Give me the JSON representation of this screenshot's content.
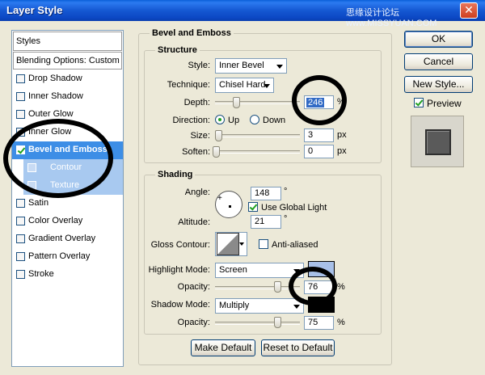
{
  "window": {
    "title": "Layer Style",
    "watermark": "思缘设计论坛 www.MISSYUAN.COM",
    "close_glyph": "✕"
  },
  "styles_panel": {
    "header": "Styles",
    "blending": "Blending Options: Custom",
    "items": [
      {
        "label": "Drop Shadow",
        "checked": false
      },
      {
        "label": "Inner Shadow",
        "checked": false
      },
      {
        "label": "Outer Glow",
        "checked": false
      },
      {
        "label": "Inner Glow",
        "checked": false
      },
      {
        "label": "Bevel and Emboss",
        "checked": true,
        "selected": true
      },
      {
        "label": "Contour",
        "checked": false,
        "sub": true
      },
      {
        "label": "Texture",
        "checked": false,
        "sub": true
      },
      {
        "label": "Satin",
        "checked": false
      },
      {
        "label": "Color Overlay",
        "checked": false
      },
      {
        "label": "Gradient Overlay",
        "checked": false
      },
      {
        "label": "Pattern Overlay",
        "checked": false
      },
      {
        "label": "Stroke",
        "checked": false
      }
    ]
  },
  "bevel": {
    "section_title": "Bevel and Emboss",
    "structure": {
      "title": "Structure",
      "style_label": "Style:",
      "style_value": "Inner Bevel",
      "technique_label": "Technique:",
      "technique_value": "Chisel Hard",
      "depth_label": "Depth:",
      "depth_value": "246",
      "depth_unit": "%",
      "direction_label": "Direction:",
      "direction_up": "Up",
      "direction_down": "Down",
      "size_label": "Size:",
      "size_value": "3",
      "size_unit": "px",
      "soften_label": "Soften:",
      "soften_value": "0",
      "soften_unit": "px"
    },
    "shading": {
      "title": "Shading",
      "angle_label": "Angle:",
      "angle_value": "148",
      "degree": "°",
      "global_light_label": "Use Global Light",
      "global_light_checked": true,
      "altitude_label": "Altitude:",
      "altitude_value": "21",
      "gloss_label": "Gloss Contour:",
      "anti_aliased_label": "Anti-aliased",
      "anti_aliased_checked": false,
      "highlight_label": "Highlight Mode:",
      "highlight_value": "Screen",
      "highlight_color": "#a8c0e8",
      "highlight_opacity_label": "Opacity:",
      "highlight_opacity_value": "76",
      "shadow_label": "Shadow Mode:",
      "shadow_value": "Multiply",
      "shadow_color": "#000000",
      "shadow_opacity_label": "Opacity:",
      "shadow_opacity_value": "75",
      "pct": "%"
    },
    "make_default": "Make Default",
    "reset_default": "Reset to Default"
  },
  "actions": {
    "ok": "OK",
    "cancel": "Cancel",
    "new_style": "New Style...",
    "preview_label": "Preview",
    "preview_checked": true
  },
  "colors": {
    "selection_blue": "#3d8ee6",
    "sub_item_blue": "#a8c9f0",
    "dialog_bg": "#ece9d8"
  }
}
